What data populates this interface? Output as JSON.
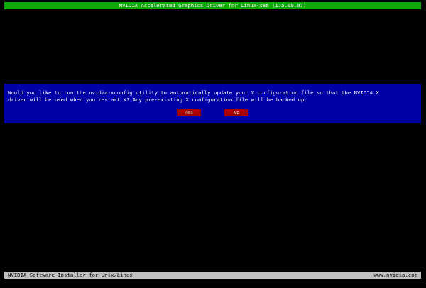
{
  "colors": {
    "background": "#000000",
    "title_bar": "#0aa80a",
    "dialog": "#0000a8",
    "button": "#a80000",
    "footer_bar": "#c0c0c0"
  },
  "header": {
    "title": "NVIDIA Accelerated Graphics Driver for Linux-x86 (175.09.07)"
  },
  "dialog": {
    "message_line_1": "Would you like to run the nvidia-xconfig utility to automatically update your X configuration file so that the NVIDIA X",
    "message_line_2": "driver will be used when you restart X?  Any pre-existing X configuration file will be backed up.",
    "yes_label": "Yes",
    "no_label": "No",
    "selected": "Yes"
  },
  "footer": {
    "left_text": "NVIDIA Software Installer for Unix/Linux",
    "right_text": "www.nvidia.com"
  }
}
